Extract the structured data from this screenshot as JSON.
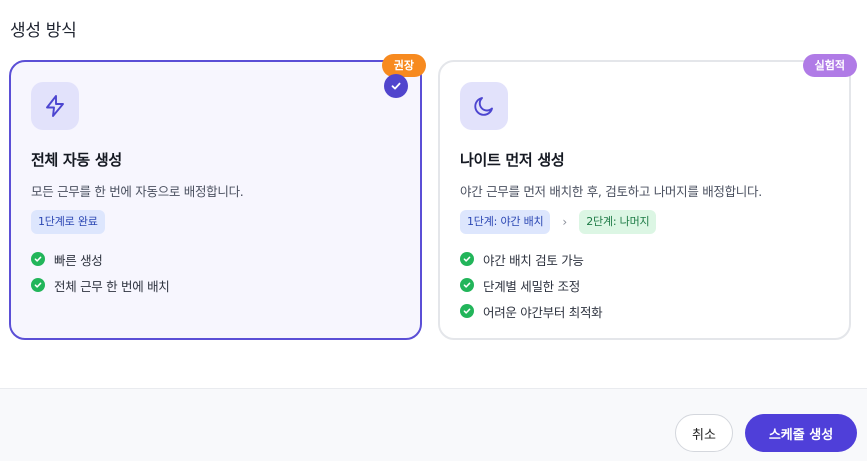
{
  "section": {
    "title": "생성 방식"
  },
  "options": [
    {
      "badge": "권장",
      "icon": "lightning-icon",
      "title": "전체 자동 생성",
      "description": "모든 근무를 한 번에 자동으로 배정합니다.",
      "steps": [
        "1단계로 완료"
      ],
      "features": [
        "빠른 생성",
        "전체 근무 한 번에 배치"
      ],
      "selected": true
    },
    {
      "badge": "실험적",
      "icon": "moon-icon",
      "title": "나이트 먼저 생성",
      "description": "야간 근무를 먼저 배치한 후, 검토하고 나머지를 배정합니다.",
      "steps": [
        "1단계: 야간 배치",
        "2단계: 나머지"
      ],
      "features": [
        "야간 배치 검토 가능",
        "단계별 세밀한 조정",
        "어려운 야간부터 최적화"
      ],
      "selected": false
    }
  ],
  "footer": {
    "cancel_label": "취소",
    "submit_label": "스케줄 생성"
  },
  "colors": {
    "accent": "#5145cd",
    "recommended": "#f78a1f",
    "experimental": "#b07be6",
    "success": "#22b55a"
  }
}
